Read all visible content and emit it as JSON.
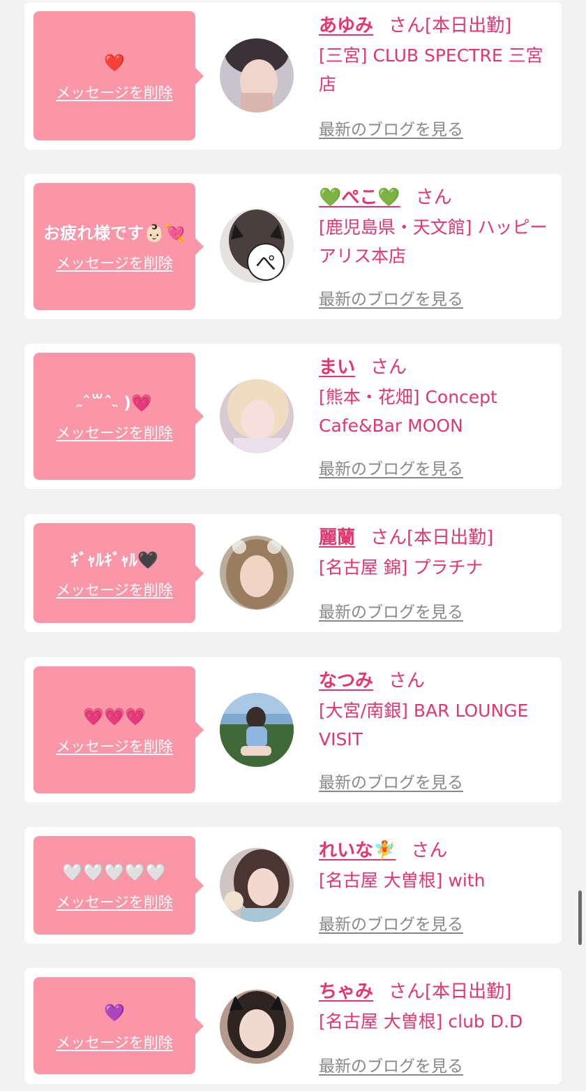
{
  "common": {
    "san": "さん",
    "delete_label": "メッセージを削除",
    "blog_label": "最新のブログを見る"
  },
  "colors": {
    "background": "#f2f2f2",
    "bubble": "#fb95a8",
    "accent": "#e6346c",
    "link_gray": "#888888"
  },
  "entries": [
    {
      "message": "❤️",
      "name": "あゆみ",
      "status": "[本日出勤]",
      "shop": "[三宮] CLUB SPECTRE 三宮店",
      "avatar_icon": "avatar-photo-ayumi"
    },
    {
      "message": "お疲れ様です👶🏻💘",
      "name": "💚ぺこ💚",
      "status": "",
      "shop": "[鹿児島県・天文館] ハッピーアリス本店",
      "avatar_icon": "avatar-photo-peko"
    },
    {
      "message": "˶ˆ꒳ˆ˵ )💗",
      "name": "まい",
      "status": "",
      "shop": "[熊本・花畑] Concept Cafe&Bar MOON",
      "avatar_icon": "avatar-photo-mai"
    },
    {
      "message": "ｷﾞｬﾙｷﾞｬﾙ🖤",
      "name": "麗蘭",
      "status": "[本日出勤]",
      "shop": "[名古屋 錦] プラチナ",
      "avatar_icon": "avatar-photo-reiran"
    },
    {
      "message": "💗💗💗",
      "name": "なつみ",
      "status": "",
      "shop": "[大宮/南銀]  BAR LOUNGE VISIT",
      "avatar_icon": "avatar-photo-natsumi"
    },
    {
      "message": "🤍🤍🤍🤍🤍",
      "name": "れいな🧚",
      "status": "",
      "shop": "[名古屋 大曽根] with",
      "avatar_icon": "avatar-photo-reina"
    },
    {
      "message": "💜",
      "name": "ちゃみ",
      "status": "[本日出勤]",
      "shop": "[名古屋 大曽根] club D.D",
      "avatar_icon": "avatar-photo-chami"
    }
  ]
}
